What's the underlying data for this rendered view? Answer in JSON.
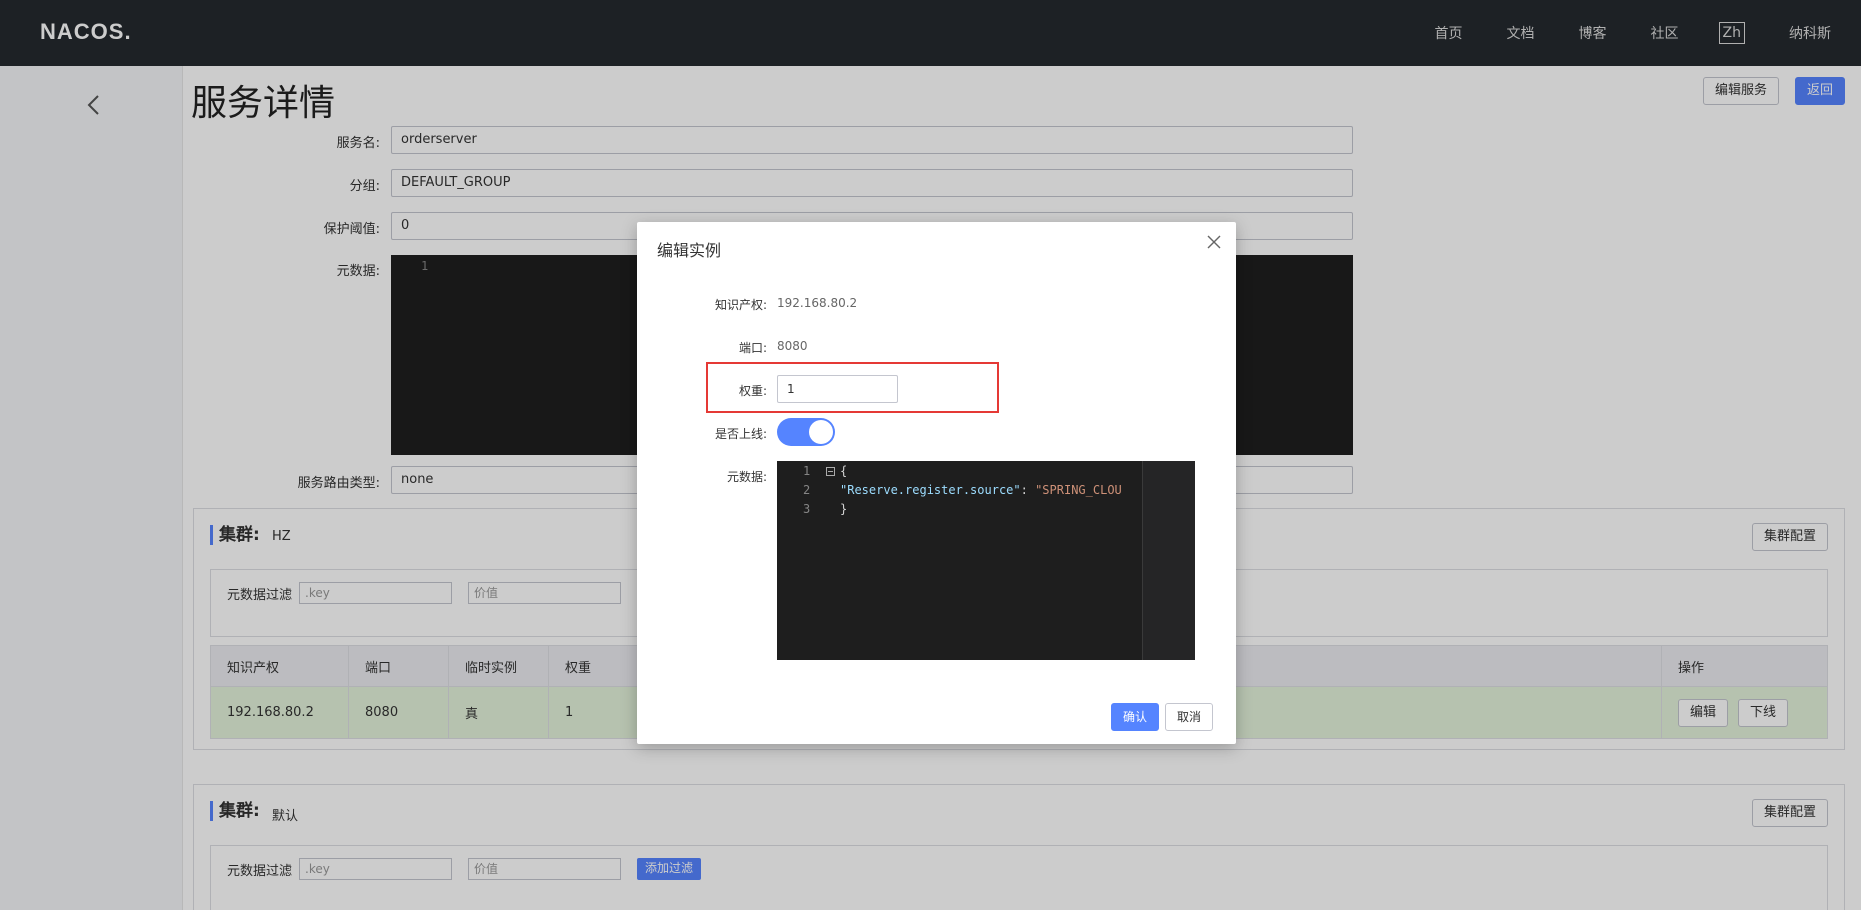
{
  "topbar": {
    "logo": "NACOS.",
    "nav": [
      "首页",
      "文档",
      "博客",
      "社区"
    ],
    "lang": "Zh",
    "brand_cn": "纳科斯"
  },
  "page": {
    "title": "服务详情",
    "edit_service_label": "编辑服务",
    "back_label": "返回"
  },
  "service_form": {
    "name_label": "服务名:",
    "name_value": "orderserver",
    "group_label": "分组:",
    "group_value": "DEFAULT_GROUP",
    "threshold_label": "保护阈值:",
    "threshold_value": "0",
    "metadata_label": "元数据:",
    "metadata_line": "1",
    "selector_label": "服务路由类型:",
    "selector_value": "none"
  },
  "clusters": [
    {
      "title": "集群:",
      "name": "HZ",
      "config_label": "集群配置",
      "filter_label": "元数据过滤",
      "filter_key_placeholder": ".key",
      "filter_value_placeholder": "价值",
      "columns": [
        "知识产权",
        "端口",
        "临时实例",
        "权重",
        "操作"
      ],
      "rows": [
        {
          "ip": "192.168.80.2",
          "port": "8080",
          "ephemeral": "真",
          "weight": "1",
          "edit_label": "编辑",
          "offline_label": "下线"
        }
      ]
    },
    {
      "title": "集群:",
      "name": "默认",
      "config_label": "集群配置",
      "filter_label": "元数据过滤",
      "filter_key_placeholder": ".key",
      "filter_value_placeholder": "价值",
      "add_filter_label": "添加过滤"
    }
  ],
  "modal": {
    "title": "编辑实例",
    "ip_label": "知识产权:",
    "ip_value": "192.168.80.2",
    "port_label": "端口:",
    "port_value": "8080",
    "weight_label": "权重:",
    "weight_value": "1",
    "online_label": "是否上线:",
    "online": true,
    "metadata_label": "元数据:",
    "metadata_lines": [
      "1",
      "2",
      "3"
    ],
    "metadata_open": "{",
    "metadata_key": "\"Reserve.register.source\"",
    "metadata_sep": ": ",
    "metadata_val": "\"SPRING_CLOU",
    "metadata_close": "}",
    "confirm_label": "确认",
    "cancel_label": "取消"
  }
}
